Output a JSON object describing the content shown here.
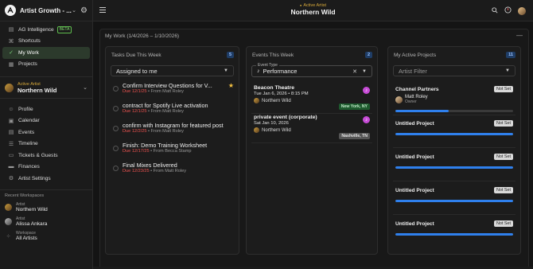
{
  "org": {
    "name": "Artist Growth - ..."
  },
  "sidebar": {
    "items": [
      {
        "label": "AG Intelligence",
        "badge": "BETA",
        "icon": "list-icon"
      },
      {
        "label": "Shortcuts",
        "icon": "shortcut-icon"
      },
      {
        "label": "My Work",
        "icon": "check-circle-icon",
        "active": true
      },
      {
        "label": "Projects",
        "icon": "projects-icon"
      }
    ],
    "artist": {
      "label": "Active Artist",
      "name": "Northern Wild"
    },
    "items2": [
      {
        "label": "Profile",
        "icon": "user-icon"
      },
      {
        "label": "Calendar",
        "icon": "calendar-icon"
      },
      {
        "label": "Events",
        "icon": "events-icon"
      },
      {
        "label": "Timeline",
        "icon": "timeline-icon"
      },
      {
        "label": "Tickets & Guests",
        "icon": "ticket-icon"
      },
      {
        "label": "Finances",
        "icon": "finances-icon"
      },
      {
        "label": "Artist Settings",
        "icon": "artist-settings-icon"
      }
    ],
    "recent": {
      "title": "Recent Workspaces",
      "items": [
        {
          "sub": "Artist",
          "name": "Northern Wild"
        },
        {
          "sub": "Artist",
          "name": "Alissa Ankara"
        },
        {
          "sub": "Workspace",
          "name": "All Artists"
        }
      ]
    }
  },
  "topbar": {
    "label": "Active Artist",
    "name": "Northern Wild"
  },
  "main": {
    "title": "My Work (1/4/2026 – 1/10/2026)",
    "tasks": {
      "title": "Tasks Due This Week",
      "count": "5",
      "filter": "Assigned to me",
      "items": [
        {
          "title": "Confirm Interview Questions for V...",
          "due": "Due 12/1/25",
          "from": " • From Matt Roley",
          "starred": true
        },
        {
          "title": "contract for Spotify Live activation",
          "due": "Due 12/1/25",
          "from": " • From Matt Roley"
        },
        {
          "title": "confirm with Instagram for featured post",
          "due": "Due 12/2/25",
          "from": " • From Matt Roley"
        },
        {
          "title": "Finish: Demo Training Worksheet",
          "due": "Due 12/17/25",
          "from": " • From Becca Stamp"
        },
        {
          "title": "Final Mixes Delivered",
          "due": "Due 12/23/25",
          "from": " • From Matt Roley"
        }
      ]
    },
    "events": {
      "title": "Events This Week",
      "count": "2",
      "filter_legend": "Event Type",
      "filter_value": "Performance",
      "items": [
        {
          "name": "Beacon Theatre",
          "date": "Tue Jan 6, 2026  •  8:15 PM",
          "artist": "Northern Wild",
          "location": "New York, NY",
          "loc_style": "green"
        },
        {
          "name": "private event (corporate)",
          "date": "Sat Jan 10, 2026",
          "artist": "Northern Wild",
          "location": "Nashville, TN",
          "loc_style": "grey"
        }
      ]
    },
    "projects": {
      "title": "My Active Projects",
      "count": "11",
      "filter": "Artist Filter",
      "items": [
        {
          "name": "Channel Partners",
          "status": "Not Set",
          "owner": "Matt Roley",
          "role": "Owner",
          "progress": 0.45
        },
        {
          "name": "Untitled Project",
          "status": "Not Set",
          "progress": 1.0
        },
        {
          "name": "Untitled Project",
          "status": "Not Set",
          "progress": 1.0
        },
        {
          "name": "Untitled Project",
          "status": "Not Set",
          "progress": 1.0
        },
        {
          "name": "Untitled Project",
          "status": "Not Set",
          "progress": 1.0
        }
      ]
    }
  }
}
